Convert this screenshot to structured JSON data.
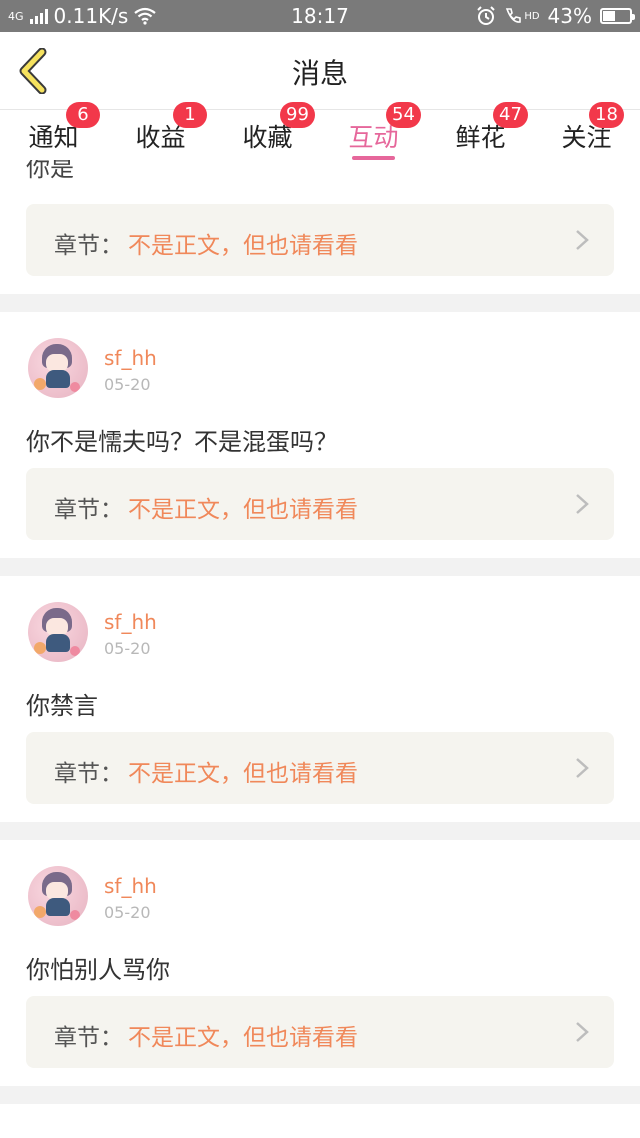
{
  "status_bar": {
    "network": "4G",
    "speed": "0.11K/s",
    "time": "18:17",
    "hd": "HD",
    "battery": "43%",
    "battery_level": 0.43
  },
  "header": {
    "title": "消息"
  },
  "tabs": [
    {
      "label": "通知",
      "badge": "6",
      "active": false
    },
    {
      "label": "收益",
      "badge": "1",
      "active": false
    },
    {
      "label": "收藏",
      "badge": "99",
      "active": false
    },
    {
      "label": "互动",
      "badge": "54",
      "active": true
    },
    {
      "label": "鲜花",
      "badge": "47",
      "active": false
    },
    {
      "label": "关注",
      "badge": "18",
      "active": false
    }
  ],
  "partial_text": "你是",
  "chapter_label": "章节：",
  "messages": [
    {
      "user": "",
      "date": "",
      "text": "",
      "chapter": "不是正文，但也请看看"
    },
    {
      "user": "sf_hh",
      "date": "05-20",
      "text": "你不是懦夫吗？不是混蛋吗？",
      "chapter": "不是正文，但也请看看"
    },
    {
      "user": "sf_hh",
      "date": "05-20",
      "text": "你禁言",
      "chapter": "不是正文，但也请看看"
    },
    {
      "user": "sf_hh",
      "date": "05-20",
      "text": "你怕别人骂你",
      "chapter": "不是正文，但也请看看"
    }
  ],
  "colors": {
    "accent": "#e6679b",
    "badge": "#f2384a",
    "username": "#f0885a"
  }
}
